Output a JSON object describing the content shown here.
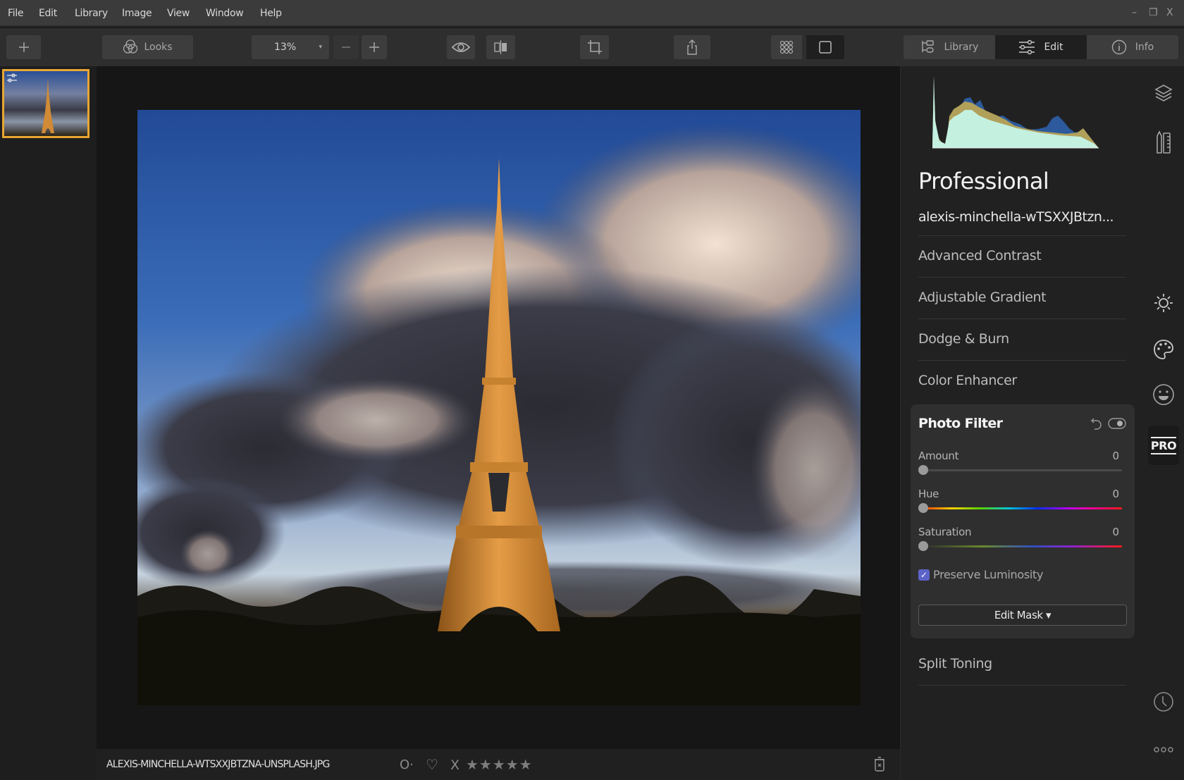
{
  "menubar": {
    "items": [
      "File",
      "Edit",
      "Library",
      "Image",
      "View",
      "Window",
      "Help"
    ],
    "window_controls": {
      "minimize": "–",
      "restore": "❐",
      "close": "X"
    }
  },
  "toolbar": {
    "add_icon": "plus-icon",
    "looks_label": "Looks",
    "zoom_value": "13%",
    "zoom_out_icon": "minus-icon",
    "zoom_in_icon": "plus-icon",
    "modes": {
      "library_label": "Library",
      "edit_label": "Edit",
      "info_label": "Info",
      "active": "Edit"
    }
  },
  "filmstrip": {
    "selected_index": 0,
    "accent_color": "#e8a632"
  },
  "bottombar": {
    "filename": "ALEXIS-MINCHELLA-WTSXXJBTZNA-UNSPLASH.JPG",
    "flag_label": "O·",
    "heart_icon": "♡",
    "reject_label": "X",
    "stars": "★★★★★",
    "star_rating": 0
  },
  "panel": {
    "title": "Professional",
    "subtitle": "alexis-minchella-wTSXXJBtzn...",
    "sections_above": [
      "Advanced Contrast",
      "Adjustable Gradient",
      "Dodge & Burn",
      "Color Enhancer"
    ],
    "photo_filter": {
      "title": "Photo Filter",
      "sliders": [
        {
          "label": "Amount",
          "value": "0"
        },
        {
          "label": "Hue",
          "value": "0"
        },
        {
          "label": "Saturation",
          "value": "0"
        }
      ],
      "preserve_luminosity_label": "Preserve Luminosity",
      "preserve_luminosity_checked": true,
      "edit_mask_label": "Edit Mask ▾",
      "checkbox_color": "#5c63c8"
    },
    "sections_below": [
      "Split Toning"
    ]
  },
  "iconbar": {
    "pro_label": "PRO",
    "items": [
      "layers-icon",
      "tools-icon",
      "sun-icon",
      "palette-icon",
      "smiley-icon",
      "pro-icon",
      "clock-icon",
      "more-icon"
    ]
  }
}
